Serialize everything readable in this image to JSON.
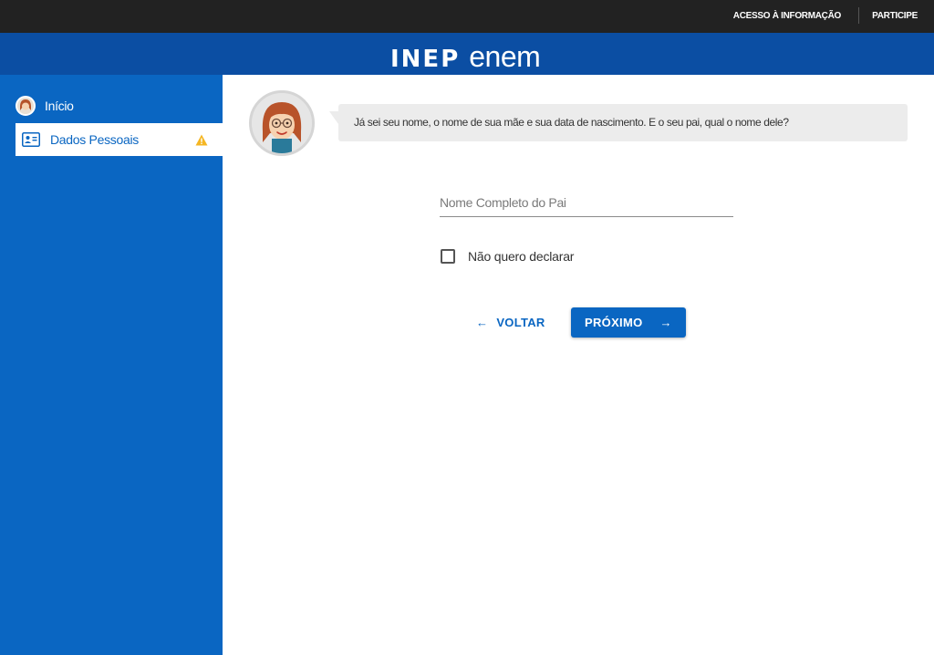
{
  "topbar": {
    "link_acesso": "ACESSO À INFORMAÇÃO",
    "link_participe": "PARTICIPE"
  },
  "header": {
    "logo_inep": "INEP",
    "logo_enem": "enem"
  },
  "sidebar": {
    "items": [
      {
        "label": "Início",
        "icon": "avatar-icon"
      },
      {
        "label": "Dados Pessoais",
        "icon": "id-card-icon",
        "status_icon": "warning-icon",
        "active": true
      }
    ]
  },
  "chat": {
    "message": "Já sei seu nome, o nome de sua mãe e sua data de nascimento. E o seu pai, qual o nome dele?"
  },
  "form": {
    "father_name": {
      "value": "",
      "placeholder": "Nome Completo do Pai"
    },
    "no_declare": {
      "label": "Não quero declarar",
      "checked": false
    }
  },
  "actions": {
    "back_label": "VOLTAR",
    "next_label": "PRÓXIMO"
  },
  "colors": {
    "topbar": "#222222",
    "header": "#0b4ea3",
    "sidebar": "#0a66c2",
    "accent": "#0a66c2",
    "warning": "#f5b623",
    "bubble": "#ececec"
  }
}
